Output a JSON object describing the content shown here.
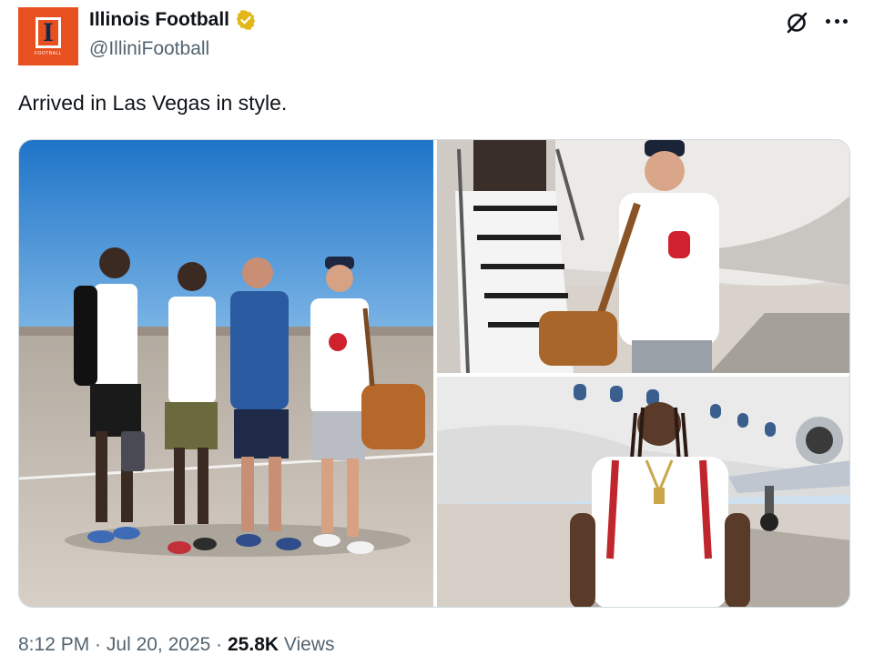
{
  "account": {
    "display_name": "Illinois Football",
    "handle": "@IlliniFootball",
    "avatar_letter": "I",
    "avatar_word": "FOOTBALL",
    "verified_color": "#e2b719",
    "avatar_color": "#e8501f"
  },
  "icons": {
    "verified": "verified-badge-icon",
    "grok": "grok-icon",
    "more": "more-options-icon"
  },
  "tweet": {
    "text": "Arrived in Las Vegas in style.",
    "time": "8:12 PM",
    "separator": " · ",
    "date": "Jul 20, 2025",
    "views_count": "25.8K",
    "views_label": " Views"
  },
  "media": [
    {
      "kind": "photo",
      "subject": "four people standing on tarmac"
    },
    {
      "kind": "photo",
      "subject": "man with bag beside jet stairs"
    },
    {
      "kind": "photo",
      "subject": "player smiling in front of jet"
    }
  ]
}
